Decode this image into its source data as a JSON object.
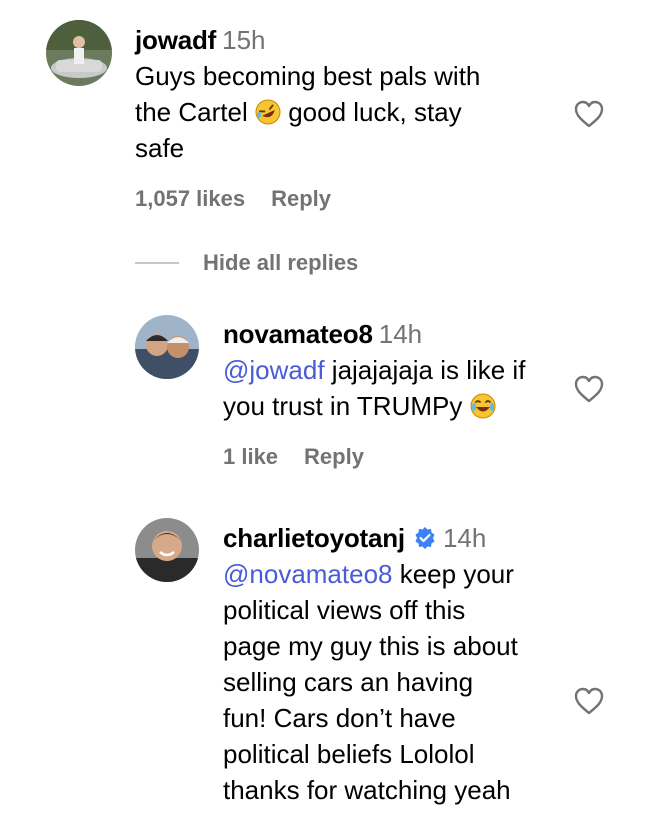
{
  "comments": [
    {
      "username": "jowadf",
      "time": "15h",
      "text_lines": "Guys becoming best pals with\nthe Cartel",
      "text_after_emoji": " good luck, stay\nsafe",
      "emoji": "rolling-on-floor-laughing",
      "likes": "1,057 likes",
      "reply": "Reply",
      "replies_toggle": "Hide all replies"
    },
    {
      "username": "novamateo8",
      "time": "14h",
      "mention": "@jowadf",
      "text": " jajajajaja is like if\nyou trust in TRUMPy ",
      "emoji": "face-with-tears-of-joy",
      "likes": "1 like",
      "reply": "Reply"
    },
    {
      "username": "charlietoyotanj",
      "verified": true,
      "time": "14h",
      "mention": "@novamateo8",
      "text": " keep your\npolitical views off this\npage my guy this is about\nselling cars an having\nfun! Cars don’t have\npolitical beliefs Lololol\nthanks for watching yeah"
    }
  ],
  "colors": {
    "mention": "#4a5bd9",
    "secondary_text": "#737373",
    "verified": "#3b82f6"
  }
}
